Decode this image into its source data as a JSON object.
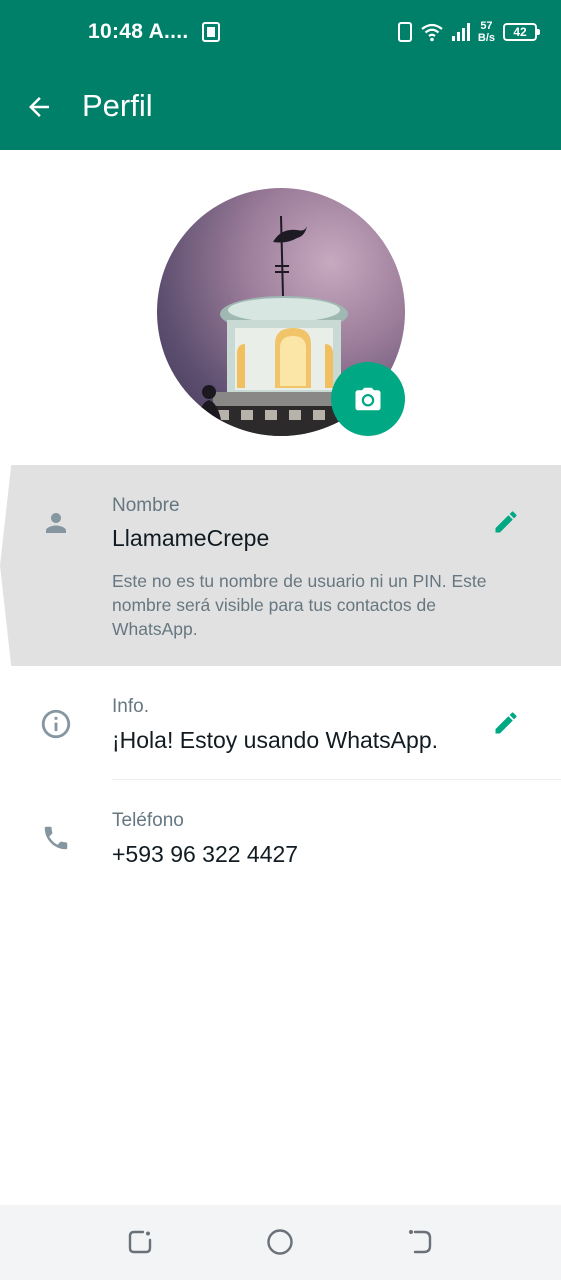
{
  "status_bar": {
    "time": "10:48 A....",
    "network_speed_value": "57",
    "network_speed_unit": "B/s",
    "battery": "42",
    "icons": [
      "app-notification-icon",
      "vibrate-icon",
      "wifi-icon",
      "signal-icon",
      "battery-icon"
    ]
  },
  "app_bar": {
    "title": "Perfil",
    "back_icon": "arrow-back-icon"
  },
  "profile": {
    "camera_icon": "camera-icon"
  },
  "name_section": {
    "label": "Nombre",
    "value": "LlamameCrepe",
    "hint": "Este no es tu nombre de usuario ni un PIN. Este nombre será visible para tus contactos de WhatsApp.",
    "icon": "person-icon",
    "edit_icon": "pencil-icon"
  },
  "info_section": {
    "label": "Info.",
    "value": "¡Hola! Estoy usando WhatsApp.",
    "icon": "info-icon",
    "edit_icon": "pencil-icon"
  },
  "phone_section": {
    "label": "Teléfono",
    "value": "+593 96 322 4427",
    "icon": "phone-icon"
  },
  "colors": {
    "brand_green": "#008069",
    "accent_green": "#00a884",
    "highlight_gray": "#e1e1e1"
  }
}
